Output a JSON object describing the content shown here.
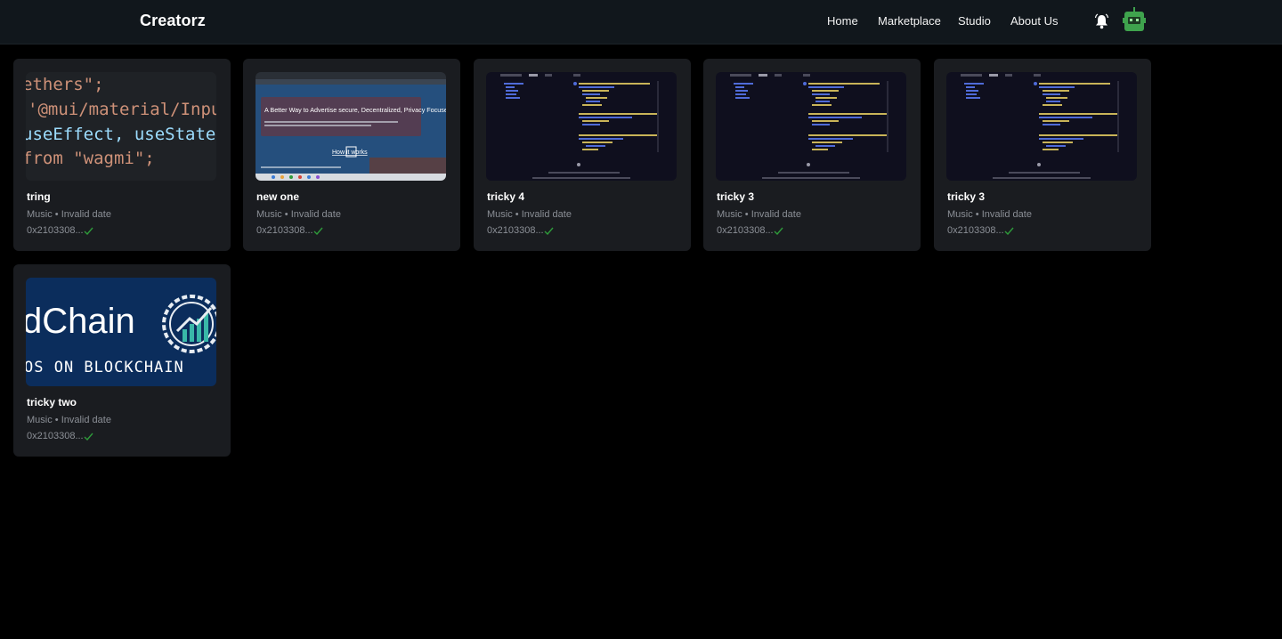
{
  "header": {
    "brand": "Creatorz",
    "nav": [
      {
        "label": "Home"
      },
      {
        "label": "Marketplace"
      },
      {
        "label": "Studio"
      },
      {
        "label": "About Us"
      }
    ],
    "icons": [
      "bell-icon",
      "robot-avatar-icon"
    ],
    "colors": {
      "bar": "#11171c",
      "avatar": "#3fa34d"
    }
  },
  "cards": [
    {
      "title": "tring",
      "meta": "Music • Invalid date",
      "address": "0x2103308...",
      "thumb": {
        "kind": "code",
        "lines": [
          "ethers\";",
          "'@mui/material/Input",
          "useEffect, useState",
          "from \"wagmi\";"
        ]
      }
    },
    {
      "title": "new one",
      "meta": "Music • Invalid date",
      "address": "0x2103308...",
      "thumb": {
        "kind": "website",
        "headline": "A Better Way to Advertise secure, Decentralized, Privacy Focused",
        "cta": "How it works"
      }
    },
    {
      "title": "tricky 4",
      "meta": "Music • Invalid date",
      "address": "0x2103308...",
      "thumb": {
        "kind": "editor"
      }
    },
    {
      "title": "tricky 3",
      "meta": "Music • Invalid date",
      "address": "0x2103308...",
      "thumb": {
        "kind": "editor"
      }
    },
    {
      "title": "tricky 3",
      "meta": "Music • Invalid date",
      "address": "0x2103308...",
      "thumb": {
        "kind": "editor"
      }
    },
    {
      "title": "tricky two",
      "meta": "Music • Invalid date",
      "address": "0x2103308...",
      "thumb": {
        "kind": "logo",
        "wordmark": "dChain",
        "tagline": "OS ON BLOCKCHAIN"
      }
    }
  ],
  "colors": {
    "card": "#1a1c20",
    "check": "#2e9b3a",
    "muted": "#8b8f96"
  }
}
